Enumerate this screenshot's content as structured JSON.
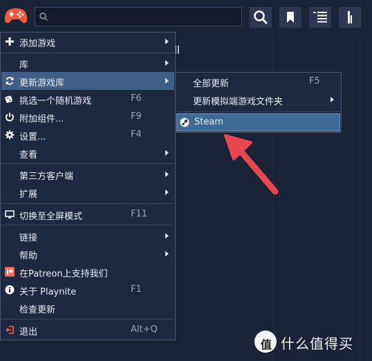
{
  "toolbar": {
    "logo_icon": "gamepad-icon",
    "search_placeholder": "",
    "buttons": [
      "search-icon",
      "bookmark-icon",
      "list-view-icon",
      "sort-icon"
    ]
  },
  "main_menu": {
    "items": [
      {
        "label": "添加游戏",
        "icon": "plus-icon",
        "shortcut": "",
        "submenu": true
      },
      {
        "label": "库",
        "icon": "",
        "shortcut": "",
        "submenu": true
      },
      {
        "label": "更新游戏库",
        "icon": "refresh-icon",
        "shortcut": "",
        "submenu": true,
        "highlighted": true
      },
      {
        "label": "挑选一个随机游戏",
        "icon": "dice-icon",
        "shortcut": "F6",
        "submenu": false
      },
      {
        "label": "附加组件...",
        "icon": "power-icon",
        "shortcut": "F9",
        "submenu": false
      },
      {
        "label": "设置...",
        "icon": "gear-icon",
        "shortcut": "F4",
        "submenu": false
      },
      {
        "label": "查看",
        "icon": "",
        "shortcut": "",
        "submenu": true
      },
      {
        "label": "第三方客户端",
        "icon": "",
        "shortcut": "",
        "submenu": true
      },
      {
        "label": "扩展",
        "icon": "",
        "shortcut": "",
        "submenu": true
      },
      {
        "label": "切换至全屏模式",
        "icon": "monitor-icon",
        "shortcut": "F11",
        "submenu": false
      },
      {
        "label": "链接",
        "icon": "",
        "shortcut": "",
        "submenu": true
      },
      {
        "label": "帮助",
        "icon": "",
        "shortcut": "",
        "submenu": true
      },
      {
        "label": "在Patreon上支持我们",
        "icon": "patreon-icon",
        "shortcut": "",
        "submenu": false
      },
      {
        "label": "关于 Playnite",
        "icon": "info-icon",
        "shortcut": "F1",
        "submenu": false
      },
      {
        "label": "检查更新",
        "icon": "",
        "shortcut": "",
        "submenu": false
      },
      {
        "label": "退出",
        "icon": "exit-icon",
        "shortcut": "Alt+Q",
        "submenu": false
      }
    ]
  },
  "sub_menu": {
    "items": [
      {
        "label": "全部更新",
        "shortcut": "F5",
        "submenu": false
      },
      {
        "label": "更新模拟端游戏文件夹",
        "shortcut": "",
        "submenu": true
      },
      {
        "label": "Steam",
        "icon": "steam-icon",
        "shortcut": "",
        "submenu": false,
        "highlighted": true
      }
    ]
  },
  "annotation": {
    "color": "#e8474f"
  },
  "watermark": {
    "badge": "值",
    "text": "什么值得买"
  },
  "colors": {
    "highlight": "#3d5f87",
    "menu_bg": "#1e2841",
    "accent_red": "#e8474f"
  }
}
